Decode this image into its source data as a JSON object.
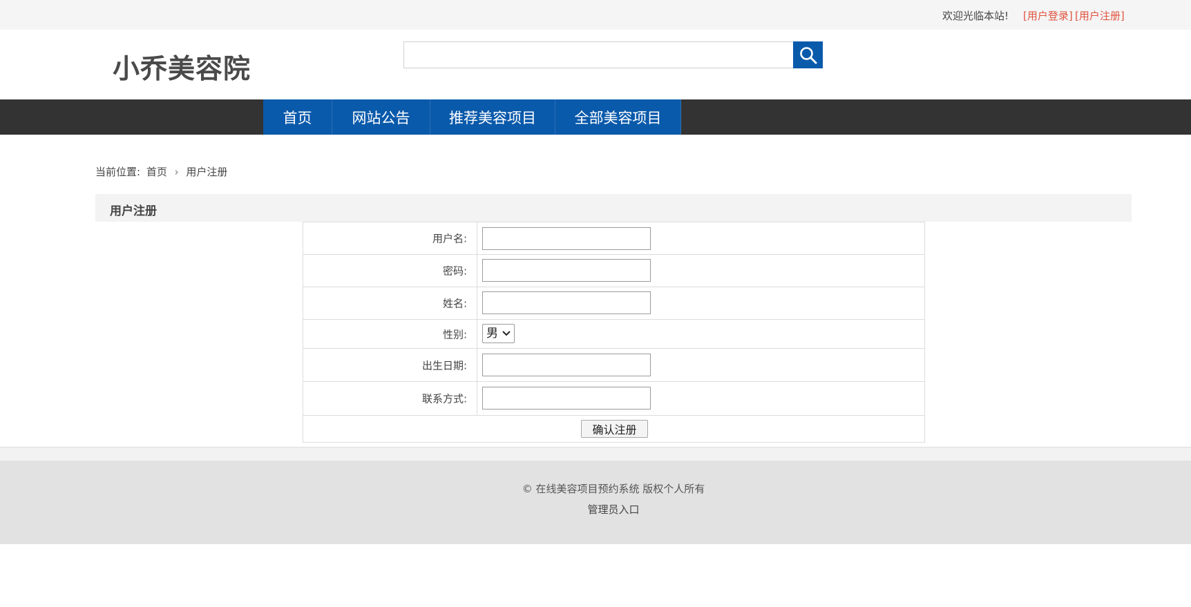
{
  "topbar": {
    "welcome": "欢迎光临本站!",
    "login_link": "[用户登录]",
    "register_link": "[用户注册]"
  },
  "header": {
    "logo": "小乔美容院",
    "search": {
      "value": "",
      "placeholder": ""
    }
  },
  "nav": {
    "items": [
      {
        "label": "首页"
      },
      {
        "label": "网站公告"
      },
      {
        "label": "推荐美容项目"
      },
      {
        "label": "全部美容项目"
      }
    ]
  },
  "breadcrumb": {
    "prefix": "当前位置:",
    "home": "首页",
    "current": "用户注册"
  },
  "section": {
    "title": "用户注册"
  },
  "form": {
    "username_label": "用户名:",
    "password_label": "密码:",
    "name_label": "姓名:",
    "gender_label": "性别:",
    "gender_value": "男",
    "birth_label": "出生日期:",
    "contact_label": "联系方式:",
    "submit_label": "确认注册"
  },
  "footer": {
    "copyright": "© 在线美容项目预约系统 版权个人所有",
    "admin_link": "管理员入口"
  },
  "colors": {
    "brand_blue": "#0a5aab",
    "nav_dark": "#333333",
    "link_red": "#e0533f"
  }
}
